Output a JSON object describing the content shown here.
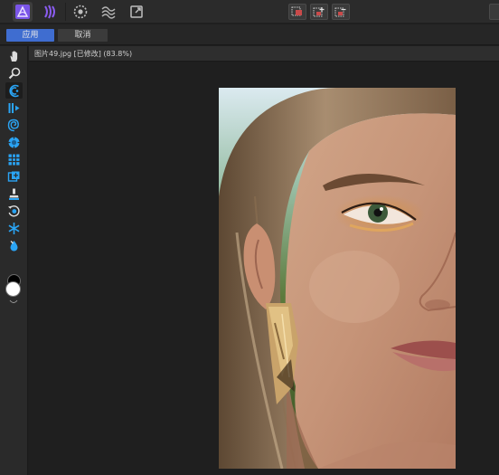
{
  "toolbar": {
    "persona_buttons": [
      {
        "name": "photo-persona-icon",
        "active": true
      },
      {
        "name": "liquify-persona-icon",
        "active": false
      },
      {
        "name": "develop-persona-icon",
        "active": false
      },
      {
        "name": "tone-mapping-persona-icon",
        "active": false
      },
      {
        "name": "export-persona-icon",
        "active": false
      }
    ],
    "center_buttons": [
      "quick-mask-icon",
      "mask-add-icon",
      "mask-subtract-icon"
    ]
  },
  "context": {
    "apply_label": "应用",
    "cancel_label": "取消"
  },
  "document": {
    "title": "图片49.jpg [已修改] (83.8%)"
  },
  "tools": [
    {
      "name": "hand-tool-icon",
      "active": false
    },
    {
      "name": "zoom-tool-icon",
      "active": false
    },
    {
      "name": "push-forward-tool-icon",
      "active": true
    },
    {
      "name": "push-left-tool-icon",
      "active": false
    },
    {
      "name": "twirl-tool-icon",
      "active": false
    },
    {
      "name": "pinch-tool-icon",
      "active": false
    },
    {
      "name": "mesh-clone-tool-icon",
      "active": false
    },
    {
      "name": "turbulence-tool-icon",
      "active": false
    },
    {
      "name": "freeze-tool-icon",
      "active": false
    },
    {
      "name": "reconstruct-tool-icon",
      "active": false
    },
    {
      "name": "thaw-tool-icon",
      "active": false
    },
    {
      "name": "liquify-mask-tool-icon",
      "active": false
    }
  ],
  "colors": {
    "accent": "#3f6dd0",
    "persona_purple": "#7a55e8",
    "tool_blue": "#2aa4f4",
    "canvas": "#1f1f1f"
  }
}
